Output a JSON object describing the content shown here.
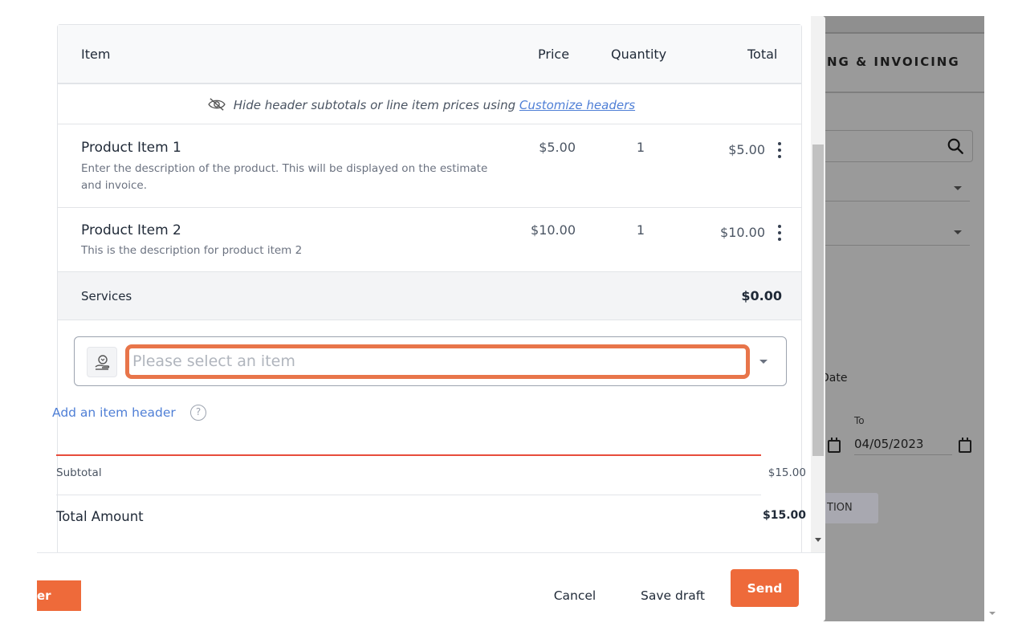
{
  "background_app": {
    "section_title": "NG & INVOICING",
    "date_label": "Date",
    "to_label": "To",
    "to_date": "04/05/2023",
    "partial_button": "TION",
    "icons": [
      "search-icon",
      "calendar-icon",
      "chevron-down-icon"
    ]
  },
  "table": {
    "headers": {
      "item": "Item",
      "price": "Price",
      "quantity": "Quantity",
      "total": "Total"
    },
    "hint": {
      "text": "Hide header subtotals or line item prices using",
      "link": "Customize headers",
      "icon": "eye-off-icon"
    },
    "items": [
      {
        "name": "Product Item 1",
        "description": "Enter the description of the product. This will be displayed on the estimate and invoice.",
        "price": "$5.00",
        "quantity": "1",
        "total": "$5.00"
      },
      {
        "name": "Product Item 2",
        "description": "This is the description for product item 2",
        "price": "$10.00",
        "quantity": "1",
        "total": "$10.00"
      }
    ],
    "services": {
      "label": "Services",
      "total": "$0.00"
    },
    "item_select": {
      "placeholder": "Please select an item",
      "icon": "box-hand-icon"
    },
    "highlight_color": "#e8754a"
  },
  "add_item_header": {
    "label": "Add an item header",
    "help": "?"
  },
  "summary": {
    "subtotal_label": "Subtotal",
    "subtotal_value": "$15.00",
    "total_label": "Total Amount",
    "total_value": "$15.00",
    "divider_color": "#e74c3c"
  },
  "footer": {
    "left_button": "er",
    "cancel": "Cancel",
    "save_draft": "Save draft",
    "send": "Send",
    "accent_color": "#ee6a3a"
  }
}
